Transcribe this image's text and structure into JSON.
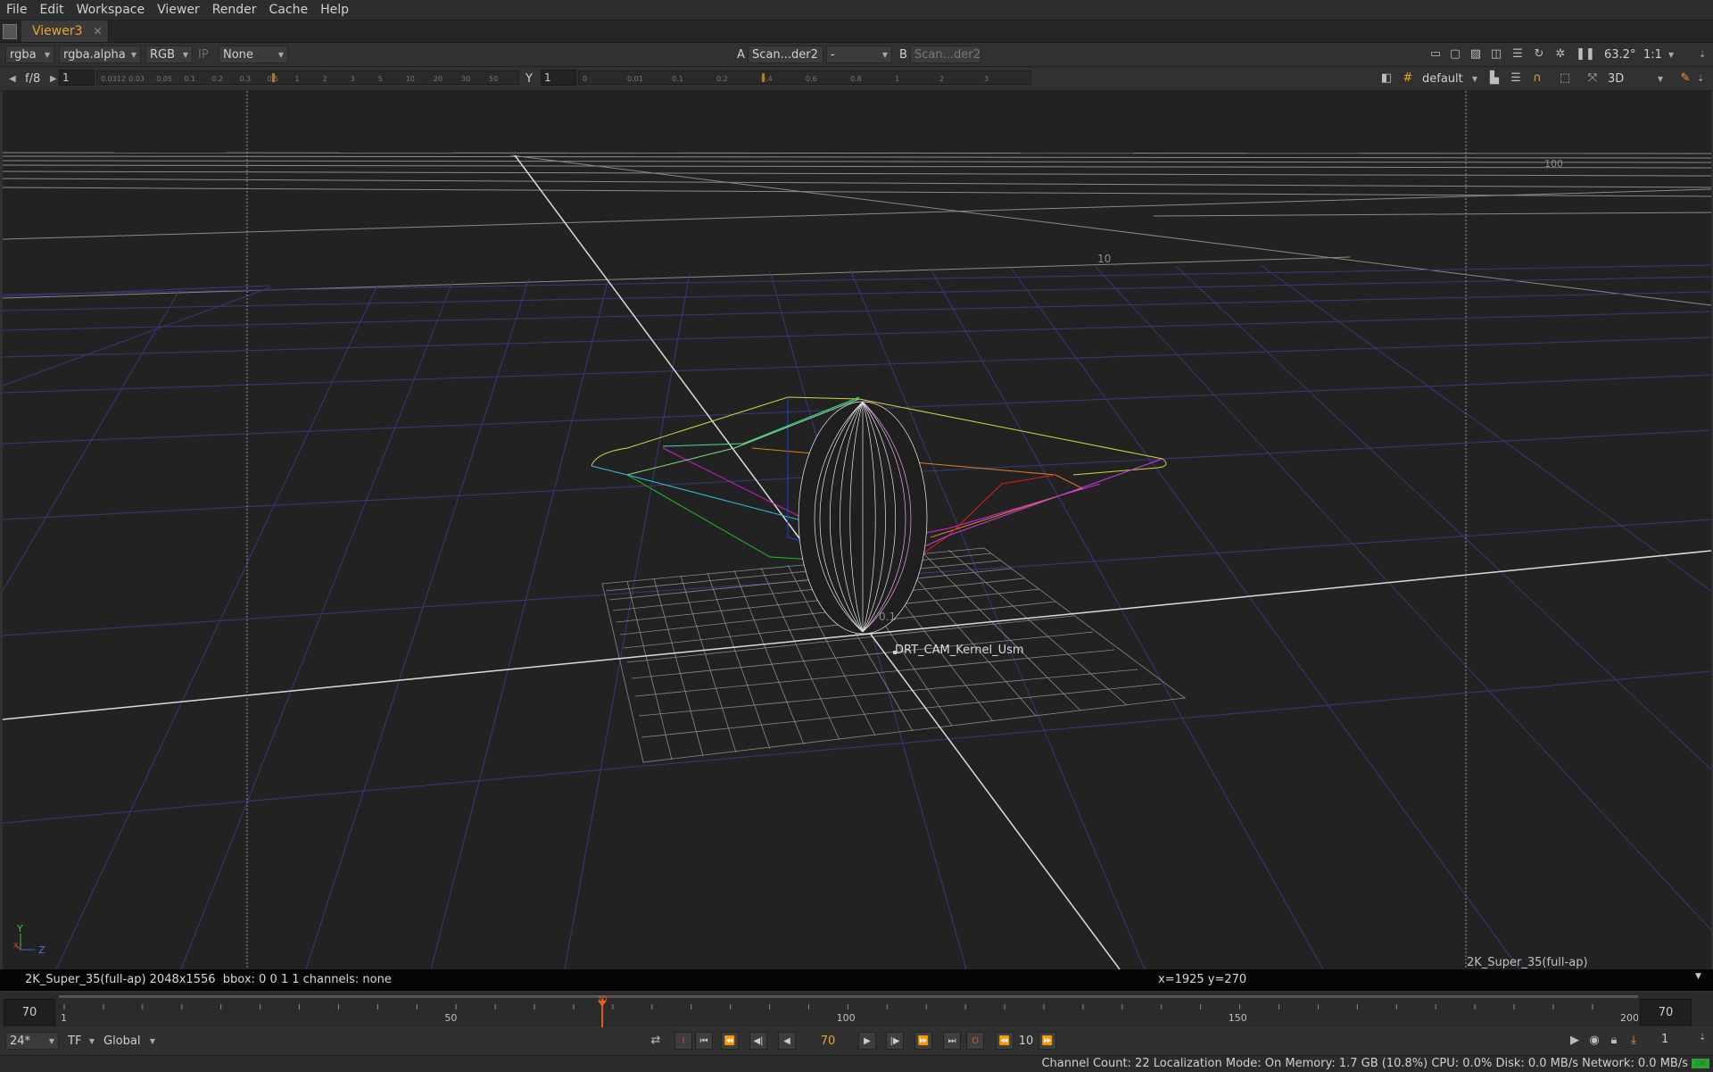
{
  "menubar": {
    "items": [
      "File",
      "Edit",
      "Workspace",
      "Viewer",
      "Render",
      "Cache",
      "Help"
    ]
  },
  "tab": {
    "label": "Viewer3",
    "close": "✕"
  },
  "toolbar1": {
    "layer": "rgba",
    "alpha_channel": "rgba.alpha",
    "display_channels": "RGB",
    "ip_label": "IP",
    "lut": "None",
    "input_a_label": "A",
    "input_a": "Scan...der2",
    "wipe_mode": "-",
    "input_b_label": "B",
    "input_b": "Scan...der2",
    "zoom": "63.2°",
    "ratio": "1:1"
  },
  "toolbar2": {
    "fstop": "f/8",
    "gain_value": "1",
    "gain_ticks": [
      "0.0312",
      "0.03",
      "0.05",
      "0.1",
      "0.2",
      "0.3",
      "0.5",
      "1",
      "2",
      "3",
      "5",
      "10",
      "20",
      "30",
      "50"
    ],
    "gamma_label": "Y",
    "gamma_value": "1",
    "gamma_ticks": [
      "0",
      "0.01",
      "0.1",
      "0.2",
      "0.4",
      "0.6",
      "0.8",
      "1",
      "2",
      "3"
    ],
    "view_preset": "default",
    "view_mode": "3D"
  },
  "viewport": {
    "label_100": "100",
    "label_10": "10",
    "label_01": "0.1",
    "node_label": "DRT_CAM_Kernel_Usm",
    "format_label": "2K_Super_35(full-ap)",
    "axis_y": "Y",
    "axis_z": "Z",
    "axis_x": "X"
  },
  "infobar": {
    "format": "2K_Super_35(full-ap) 2048x1556  bbox: 0 0 1 1 channels: none",
    "coords": "x=1925 y=270"
  },
  "timeline": {
    "in_frame": "70",
    "out_frame": "70",
    "current_frame_marker": "70",
    "tick_labels": [
      "1",
      "50",
      "100",
      "150",
      "200"
    ],
    "current_fraction": 0.345
  },
  "transport": {
    "fps": "24*",
    "tf": "TF",
    "scope": "Global",
    "frame": "70",
    "increment": "10",
    "playback_count": "1"
  },
  "status": {
    "text": "Channel Count: 22 Localization Mode: On Memory: 1.7 GB (10.8%) CPU: 0.0% Disk: 0.0 MB/s Network: 0.0 MB/s",
    "ok": "OK"
  },
  "colors": {
    "accent": "#f0a030",
    "grid_blue": "#3a3a8a",
    "timeline_marker": "#e06020"
  }
}
